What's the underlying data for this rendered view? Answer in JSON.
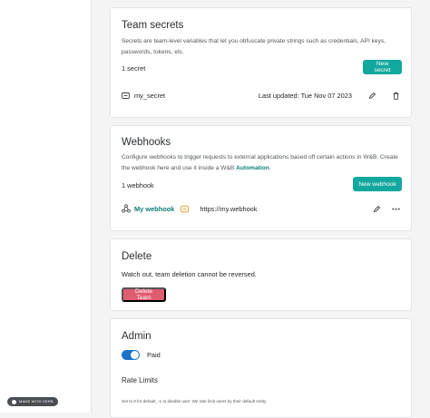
{
  "badge": {
    "made_with": "MADE WITH VERB"
  },
  "secrets": {
    "title": "Team secrets",
    "description": "Secrets are team-level variables that let you obfuscate private strings such as credentials, API keys, passwords, tokens, etc.",
    "count": "1 secret",
    "new_button": "New secret",
    "items": [
      {
        "name": "my_secret",
        "updated": "Last updated: Tue Nov 07 2023"
      }
    ]
  },
  "webhooks": {
    "title": "Webhooks",
    "description_prefix": "Configure webhooks to trigger requests to external applications based off certain actions in W&B. Create the webhook here and use it inside a W&B ",
    "description_link": "Automation",
    "description_suffix": ".",
    "count": "1 webhook",
    "new_button": "New webhook",
    "items": [
      {
        "name": "My webhook",
        "url": "https://my.webhook"
      }
    ]
  },
  "delete": {
    "title": "Delete",
    "warning": "Watch out, team deletion cannot be reversed.",
    "button": "Delete Team"
  },
  "admin": {
    "title": "Admin",
    "toggle_label": "Paid",
    "toggle_on": true,
    "rate_limits_title": "Rate Limits",
    "rate_limits_note": "Set to 0 for default, -1 to disable user. We rate limit users by their default entity."
  },
  "colors": {
    "accent": "#13a89e",
    "danger": "#e05c70",
    "toggle": "#1a73c9"
  }
}
